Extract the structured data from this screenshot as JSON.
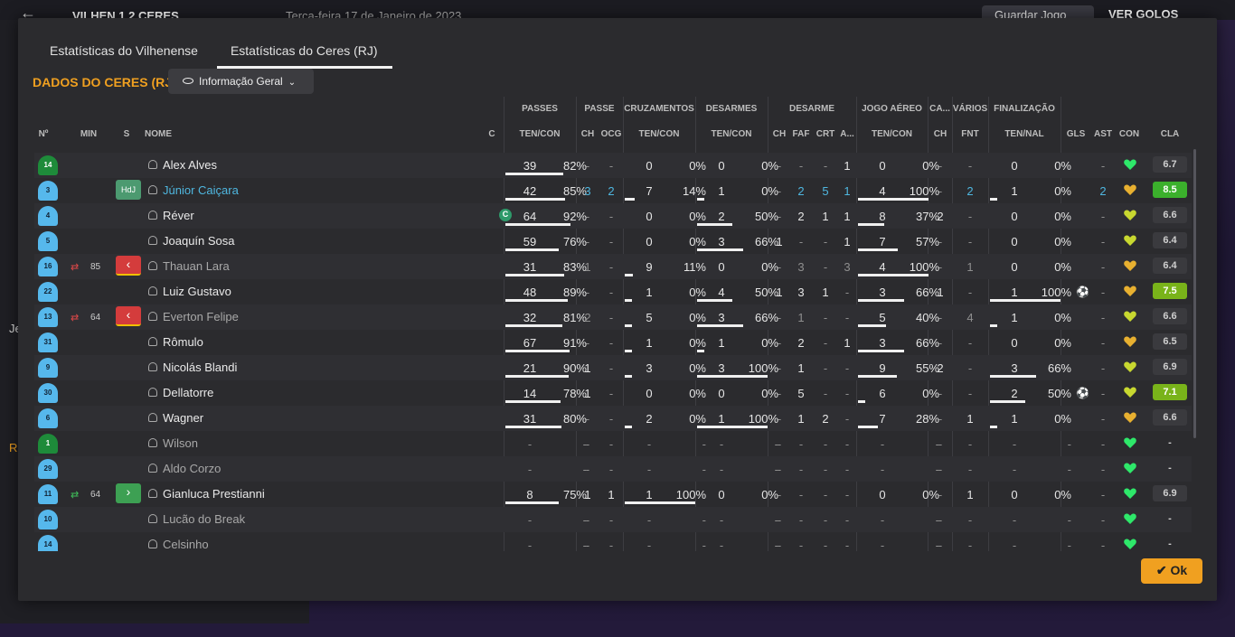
{
  "topbar": {
    "match": "VILHEN 1 2 CERES",
    "date": "Terça-feira 17 de Janeiro de 2023",
    "save": "Guardar Jogo",
    "goals": "VER GOLOS",
    "side_a": "Je",
    "side_b": "R"
  },
  "tabs": [
    "Estatísticas do Vilhenense",
    "Estatísticas do Ceres (RJ)"
  ],
  "section_title": "DADOS DO CERES (RJ)",
  "dropdown": "Informação Geral",
  "groups": {
    "passes": "PASSES",
    "passe": "PASSE",
    "cruz": "CRUZAMENTOS",
    "des": "DESARMES",
    "desarme": "DESARME",
    "aereo": "JOGO AÉREO",
    "ca": "CA...",
    "varios": "VÁRIOS",
    "final": "FINALIZAÇÃO"
  },
  "cols": {
    "num": "Nº",
    "min": "MIN",
    "s": "S",
    "nome": "NOME",
    "c": "C",
    "tencon1": "TEN/CON",
    "ch1": "CH",
    "ocg": "OCG",
    "tencon2": "TEN/CON",
    "tencon3": "TEN/CON",
    "ch2": "CH",
    "faf": "FAF",
    "crt": "CRT",
    "a": "A...",
    "tencon4": "TEN/CON",
    "ch3": "CH",
    "fnt": "FNT",
    "tennal": "TEN/NAL",
    "gls": "GLS",
    "ast": "AST",
    "con": "CON",
    "cla": "CLA"
  },
  "rows": [
    {
      "num": "14",
      "gk": true,
      "min": "",
      "s": "",
      "name": "Alex Alves",
      "p1": "39",
      "p2": "82%",
      "pf": 0.82,
      "ch": "-",
      "ocg": "-",
      "c1": "0",
      "c2": "0%",
      "cf": 0,
      "d1": "0",
      "d2": "0%",
      "df": 0,
      "dch": "-",
      "faf": "-",
      "crt": "-",
      "a": "1",
      "j1": "0",
      "j2": "0%",
      "jf": 0,
      "cach": "-",
      "fnt": "-",
      "f1": "0",
      "f2": "0%",
      "ff": 0,
      "gls": "",
      "ast": "-",
      "cla": "6.7",
      "ct": "norm"
    },
    {
      "num": "3",
      "gk": false,
      "min": "",
      "s": "HdJ",
      "name": "Júnior Caiçara",
      "p1": "42",
      "p2": "85%",
      "pf": 0.85,
      "ch": "3",
      "ocg": "2",
      "c1": "7",
      "c2": "14%",
      "cf": 0.14,
      "d1": "1",
      "d2": "0%",
      "df": 0,
      "dch": "-",
      "faf": "2",
      "crt": "5",
      "a": "1",
      "j1": "4",
      "j2": "100%",
      "jf": 1,
      "cach": "-",
      "fnt": "2",
      "f1": "1",
      "f2": "0%",
      "ff": 0,
      "gls": "",
      "ast": "2",
      "cla": "8.5",
      "ct": "hi"
    },
    {
      "num": "4",
      "gk": false,
      "min": "",
      "s": "",
      "name": "Réver",
      "cap": "C",
      "p1": "64",
      "p2": "92%",
      "pf": 0.92,
      "ch": "-",
      "ocg": "-",
      "c1": "0",
      "c2": "0%",
      "cf": 0,
      "d1": "2",
      "d2": "50%",
      "df": 0.5,
      "dch": "-",
      "faf": "2",
      "crt": "1",
      "a": "1",
      "j1": "8",
      "j2": "37%",
      "jf": 0.37,
      "cach": "2",
      "fnt": "-",
      "f1": "0",
      "f2": "0%",
      "ff": 0,
      "gls": "",
      "ast": "-",
      "cla": "6.6",
      "ct": "norm"
    },
    {
      "num": "5",
      "gk": false,
      "min": "",
      "s": "",
      "name": "Joaquín Sosa",
      "p1": "59",
      "p2": "76%",
      "pf": 0.76,
      "ch": "-",
      "ocg": "-",
      "c1": "0",
      "c2": "0%",
      "cf": 0,
      "d1": "3",
      "d2": "66%",
      "df": 0.66,
      "dch": "1",
      "faf": "-",
      "crt": "-",
      "a": "1",
      "j1": "7",
      "j2": "57%",
      "jf": 0.57,
      "cach": "-",
      "fnt": "-",
      "f1": "0",
      "f2": "0%",
      "ff": 0,
      "gls": "",
      "ast": "-",
      "cla": "6.4",
      "ct": "norm"
    },
    {
      "num": "16",
      "gk": false,
      "min": "85",
      "sub": "out",
      "s": "off",
      "name": "Thauan Lara",
      "p1": "31",
      "p2": "83%",
      "pf": 0.83,
      "ch": "1",
      "ocg": "-",
      "c1": "9",
      "c2": "11%",
      "cf": 0.11,
      "d1": "0",
      "d2": "0%",
      "df": 0,
      "dch": "-",
      "faf": "3",
      "crt": "-",
      "a": "3",
      "j1": "4",
      "j2": "100%",
      "jf": 1,
      "cach": "-",
      "fnt": "1",
      "f1": "0",
      "f2": "0%",
      "ff": 0,
      "gls": "",
      "ast": "-",
      "cla": "6.4",
      "ct": "norm",
      "subbed": true
    },
    {
      "num": "22",
      "gk": false,
      "min": "",
      "s": "",
      "name": "Luiz Gustavo",
      "p1": "48",
      "p2": "89%",
      "pf": 0.89,
      "ch": "-",
      "ocg": "-",
      "c1": "1",
      "c2": "0%",
      "cf": 0,
      "d1": "4",
      "d2": "50%",
      "df": 0.5,
      "dch": "1",
      "faf": "3",
      "crt": "1",
      "a": "-",
      "j1": "3",
      "j2": "66%",
      "jf": 0.66,
      "cach": "1",
      "fnt": "-",
      "f1": "1",
      "f2": "100%",
      "ff": 1,
      "gls": "ball",
      "ast": "-",
      "cla": "7.5",
      "ct": "mid"
    },
    {
      "num": "13",
      "gk": false,
      "min": "64",
      "sub": "out",
      "s": "off",
      "name": "Everton Felipe",
      "p1": "32",
      "p2": "81%",
      "pf": 0.81,
      "ch": "2",
      "ocg": "-",
      "c1": "5",
      "c2": "0%",
      "cf": 0,
      "d1": "3",
      "d2": "66%",
      "df": 0.66,
      "dch": "-",
      "faf": "1",
      "crt": "-",
      "a": "-",
      "j1": "5",
      "j2": "40%",
      "jf": 0.4,
      "cach": "-",
      "fnt": "4",
      "f1": "1",
      "f2": "0%",
      "ff": 0,
      "gls": "",
      "ast": "-",
      "cla": "6.6",
      "ct": "norm",
      "subbed": true
    },
    {
      "num": "31",
      "gk": false,
      "min": "",
      "s": "",
      "name": "Rômulo",
      "p1": "67",
      "p2": "91%",
      "pf": 0.91,
      "ch": "-",
      "ocg": "-",
      "c1": "1",
      "c2": "0%",
      "cf": 0,
      "d1": "1",
      "d2": "0%",
      "df": 0,
      "dch": "-",
      "faf": "2",
      "crt": "-",
      "a": "1",
      "j1": "3",
      "j2": "66%",
      "jf": 0.66,
      "cach": "-",
      "fnt": "-",
      "f1": "0",
      "f2": "0%",
      "ff": 0,
      "gls": "",
      "ast": "-",
      "cla": "6.5",
      "ct": "norm"
    },
    {
      "num": "9",
      "gk": false,
      "min": "",
      "s": "",
      "name": "Nicolás Blandi",
      "p1": "21",
      "p2": "90%",
      "pf": 0.9,
      "ch": "1",
      "ocg": "-",
      "c1": "3",
      "c2": "0%",
      "cf": 0,
      "d1": "3",
      "d2": "100%",
      "df": 1,
      "dch": "-",
      "faf": "1",
      "crt": "-",
      "a": "-",
      "j1": "9",
      "j2": "55%",
      "jf": 0.55,
      "cach": "2",
      "fnt": "-",
      "f1": "3",
      "f2": "66%",
      "ff": 0.66,
      "gls": "",
      "ast": "-",
      "cla": "6.9",
      "ct": "norm"
    },
    {
      "num": "30",
      "gk": false,
      "min": "",
      "s": "",
      "name": "Dellatorre",
      "p1": "14",
      "p2": "78%",
      "pf": 0.78,
      "ch": "1",
      "ocg": "-",
      "c1": "0",
      "c2": "0%",
      "cf": 0,
      "d1": "0",
      "d2": "0%",
      "df": 0,
      "dch": "-",
      "faf": "5",
      "crt": "-",
      "a": "-",
      "j1": "6",
      "j2": "0%",
      "jf": 0,
      "cach": "-",
      "fnt": "-",
      "f1": "2",
      "f2": "50%",
      "ff": 0.5,
      "gls": "ball",
      "ast": "-",
      "cla": "7.1",
      "ct": "mid"
    },
    {
      "num": "6",
      "gk": false,
      "min": "",
      "s": "",
      "name": "Wagner",
      "p1": "31",
      "p2": "80%",
      "pf": 0.8,
      "ch": "-",
      "ocg": "-",
      "c1": "2",
      "c2": "0%",
      "cf": 0,
      "d1": "1",
      "d2": "100%",
      "df": 1,
      "dch": "-",
      "faf": "1",
      "crt": "2",
      "a": "-",
      "j1": "7",
      "j2": "28%",
      "jf": 0.28,
      "cach": "-",
      "fnt": "1",
      "f1": "1",
      "f2": "0%",
      "ff": 0,
      "gls": "",
      "ast": "-",
      "cla": "6.6",
      "ct": "norm"
    },
    {
      "num": "1",
      "gk": true,
      "min": "",
      "s": "",
      "name": "Wilson",
      "bench": true,
      "p1": "-",
      "p2": "-",
      "pf": 0,
      "ch": "-",
      "ocg": "-",
      "c1": "-",
      "c2": "-",
      "cf": 0,
      "d1": "-",
      "d2": "-",
      "df": 0,
      "dch": "-",
      "faf": "-",
      "crt": "-",
      "a": "-",
      "j1": "-",
      "j2": "-",
      "jf": 0,
      "cach": "-",
      "fnt": "-",
      "f1": "-",
      "f2": "-",
      "ff": 0,
      "gls": "",
      "ast": "-",
      "cla": "-",
      "ct": "norm"
    },
    {
      "num": "29",
      "gk": false,
      "min": "",
      "s": "",
      "name": "Aldo Corzo",
      "bench": true,
      "p1": "-",
      "p2": "-",
      "pf": 0,
      "ch": "-",
      "ocg": "-",
      "c1": "-",
      "c2": "-",
      "cf": 0,
      "d1": "-",
      "d2": "-",
      "df": 0,
      "dch": "-",
      "faf": "-",
      "crt": "-",
      "a": "-",
      "j1": "-",
      "j2": "-",
      "jf": 0,
      "cach": "-",
      "fnt": "-",
      "f1": "-",
      "f2": "-",
      "ff": 0,
      "gls": "",
      "ast": "-",
      "cla": "-",
      "ct": "norm"
    },
    {
      "num": "11",
      "gk": false,
      "min": "64",
      "sub": "in",
      "s": "on",
      "name": "Gianluca Prestianni",
      "p1": "8",
      "p2": "75%",
      "pf": 0.75,
      "ch": "1",
      "ocg": "1",
      "c1": "1",
      "c2": "100%",
      "cf": 1,
      "d1": "0",
      "d2": "0%",
      "df": 0,
      "dch": "-",
      "faf": "-",
      "crt": "-",
      "a": "-",
      "j1": "0",
      "j2": "0%",
      "jf": 0,
      "cach": "-",
      "fnt": "1",
      "f1": "0",
      "f2": "0%",
      "ff": 0,
      "gls": "",
      "ast": "-",
      "cla": "6.9",
      "ct": "norm"
    },
    {
      "num": "10",
      "gk": false,
      "min": "",
      "s": "",
      "name": "Lucão do Break",
      "bench": true,
      "p1": "-",
      "p2": "-",
      "pf": 0,
      "ch": "-",
      "ocg": "-",
      "c1": "-",
      "c2": "-",
      "cf": 0,
      "d1": "-",
      "d2": "-",
      "df": 0,
      "dch": "-",
      "faf": "-",
      "crt": "-",
      "a": "-",
      "j1": "-",
      "j2": "-",
      "jf": 0,
      "cach": "-",
      "fnt": "-",
      "f1": "-",
      "f2": "-",
      "ff": 0,
      "gls": "",
      "ast": "-",
      "cla": "-",
      "ct": "norm"
    },
    {
      "num": "14",
      "gk": false,
      "min": "",
      "s": "",
      "name": "Celsinho",
      "bench": true,
      "p1": "-",
      "p2": "-",
      "pf": 0,
      "ch": "-",
      "ocg": "-",
      "c1": "-",
      "c2": "-",
      "cf": 0,
      "d1": "-",
      "d2": "-",
      "df": 0,
      "dch": "-",
      "faf": "-",
      "crt": "-",
      "a": "-",
      "j1": "-",
      "j2": "-",
      "jf": 0,
      "cach": "-",
      "fnt": "-",
      "f1": "-",
      "f2": "-",
      "ff": 0,
      "gls": "",
      "ast": "-",
      "cla": "-",
      "ct": "norm"
    }
  ],
  "ok": "Ok",
  "colors": {
    "accent": "#f0a020",
    "link": "#4fb7e0",
    "heart_green": "#2ee86a",
    "heart_gold": "#e8b030"
  }
}
